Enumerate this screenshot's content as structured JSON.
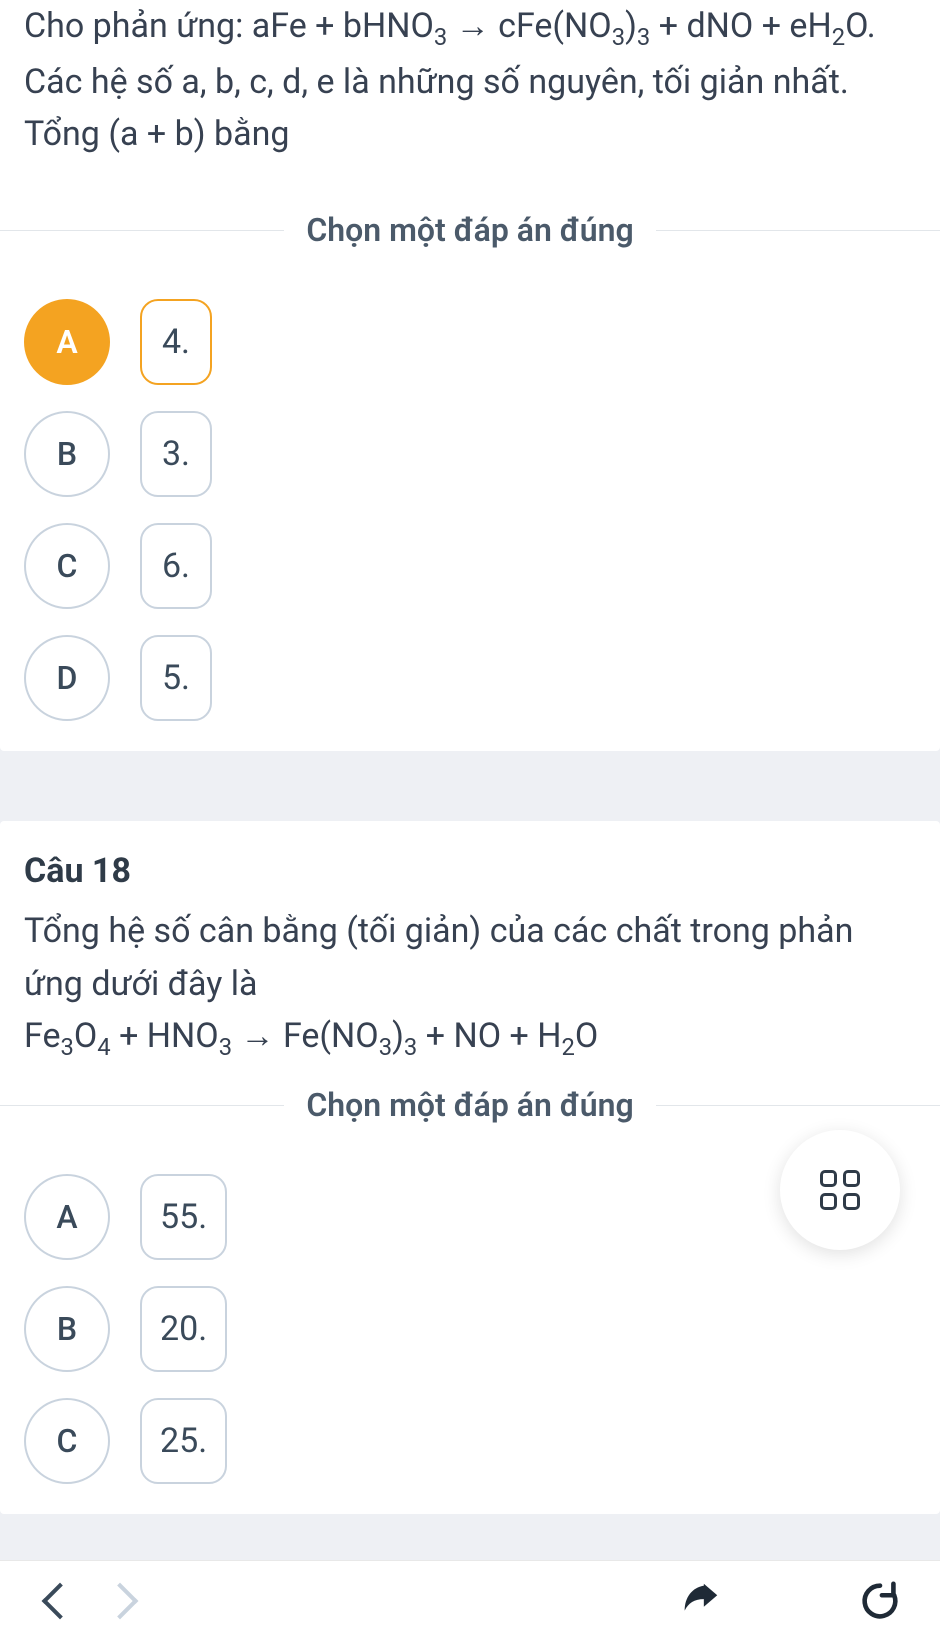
{
  "q1": {
    "question_html": "Cho phản ứng: aFe + bHNO<sub>3</sub> → cFe(NO<sub>3</sub>)<sub>3</sub> + dNO + eH<sub>2</sub>O. Các hệ số a, b, c, d, e là những số nguyên, tối giản nhất. Tổng (a + b) bằng",
    "divider": "Chọn một đáp án đúng",
    "options": [
      {
        "letter": "A",
        "text": "4.",
        "selected": true
      },
      {
        "letter": "B",
        "text": "3.",
        "selected": false
      },
      {
        "letter": "C",
        "text": "6.",
        "selected": false
      },
      {
        "letter": "D",
        "text": "5.",
        "selected": false
      }
    ]
  },
  "q2": {
    "label": "Câu 18",
    "question_line1": "Tổng hệ số cân bằng (tối giản) của các chất trong phản ứng dưới đây là",
    "question_line2_html": "Fe<sub>3</sub>O<sub>4</sub> + HNO<sub>3</sub> → Fe(NO<sub>3</sub>)<sub>3</sub> + NO + H<sub>2</sub>O",
    "divider": "Chọn một đáp án đúng",
    "options": [
      {
        "letter": "A",
        "text": "55.",
        "selected": false
      },
      {
        "letter": "B",
        "text": "20.",
        "selected": false
      },
      {
        "letter": "C",
        "text": "25.",
        "selected": false
      }
    ]
  }
}
